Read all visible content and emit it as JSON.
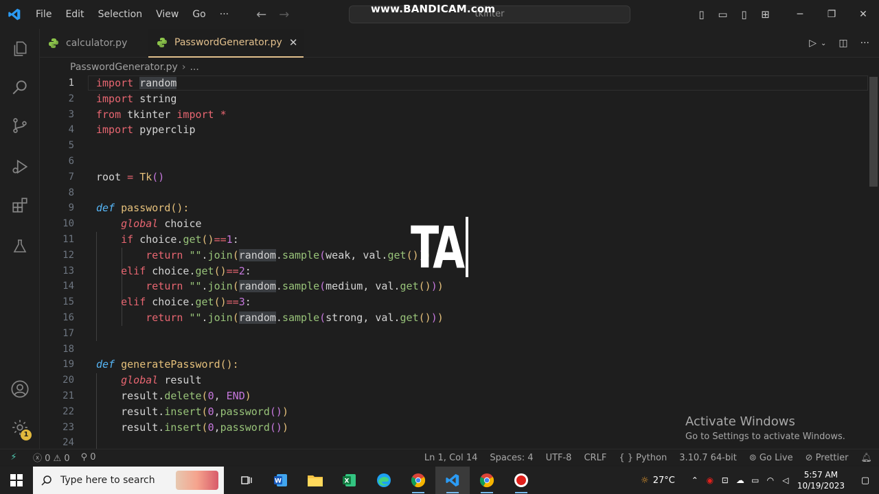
{
  "window": {
    "menu": [
      "File",
      "Edit",
      "Selection",
      "View",
      "Go",
      "···"
    ],
    "command_center": "tkinter",
    "watermark": "www.BANDICAM.com"
  },
  "tabs": [
    {
      "label": "calculator.py",
      "active": false
    },
    {
      "label": "PasswordGenerator.py",
      "active": true,
      "close": "✕"
    }
  ],
  "breadcrumb": {
    "file": "PasswordGenerator.py",
    "more": "..."
  },
  "editor": {
    "overlay_text": "TA",
    "lines": [
      "1",
      "2",
      "3",
      "4",
      "5",
      "6",
      "7",
      "8",
      "9",
      "10",
      "11",
      "12",
      "13",
      "14",
      "15",
      "16",
      "17",
      "18",
      "19",
      "20",
      "21",
      "22",
      "23",
      "24"
    ]
  },
  "activation": {
    "title": "Activate Windows",
    "subtitle": "Go to Settings to activate Windows."
  },
  "activity": {
    "badge": "1"
  },
  "status": {
    "errors": "0",
    "warnings": "0",
    "ports": "0",
    "position": "Ln 1, Col 14",
    "spaces": "Spaces: 4",
    "encoding": "UTF-8",
    "eol": "CRLF",
    "language": "Python",
    "interpreter": "3.10.7 64-bit",
    "go_live": "Go Live",
    "prettier": "Prettier"
  },
  "taskbar": {
    "search_placeholder": "Type here to search",
    "temperature": "27°C",
    "time": "5:57 AM",
    "date": "10/19/2023"
  }
}
